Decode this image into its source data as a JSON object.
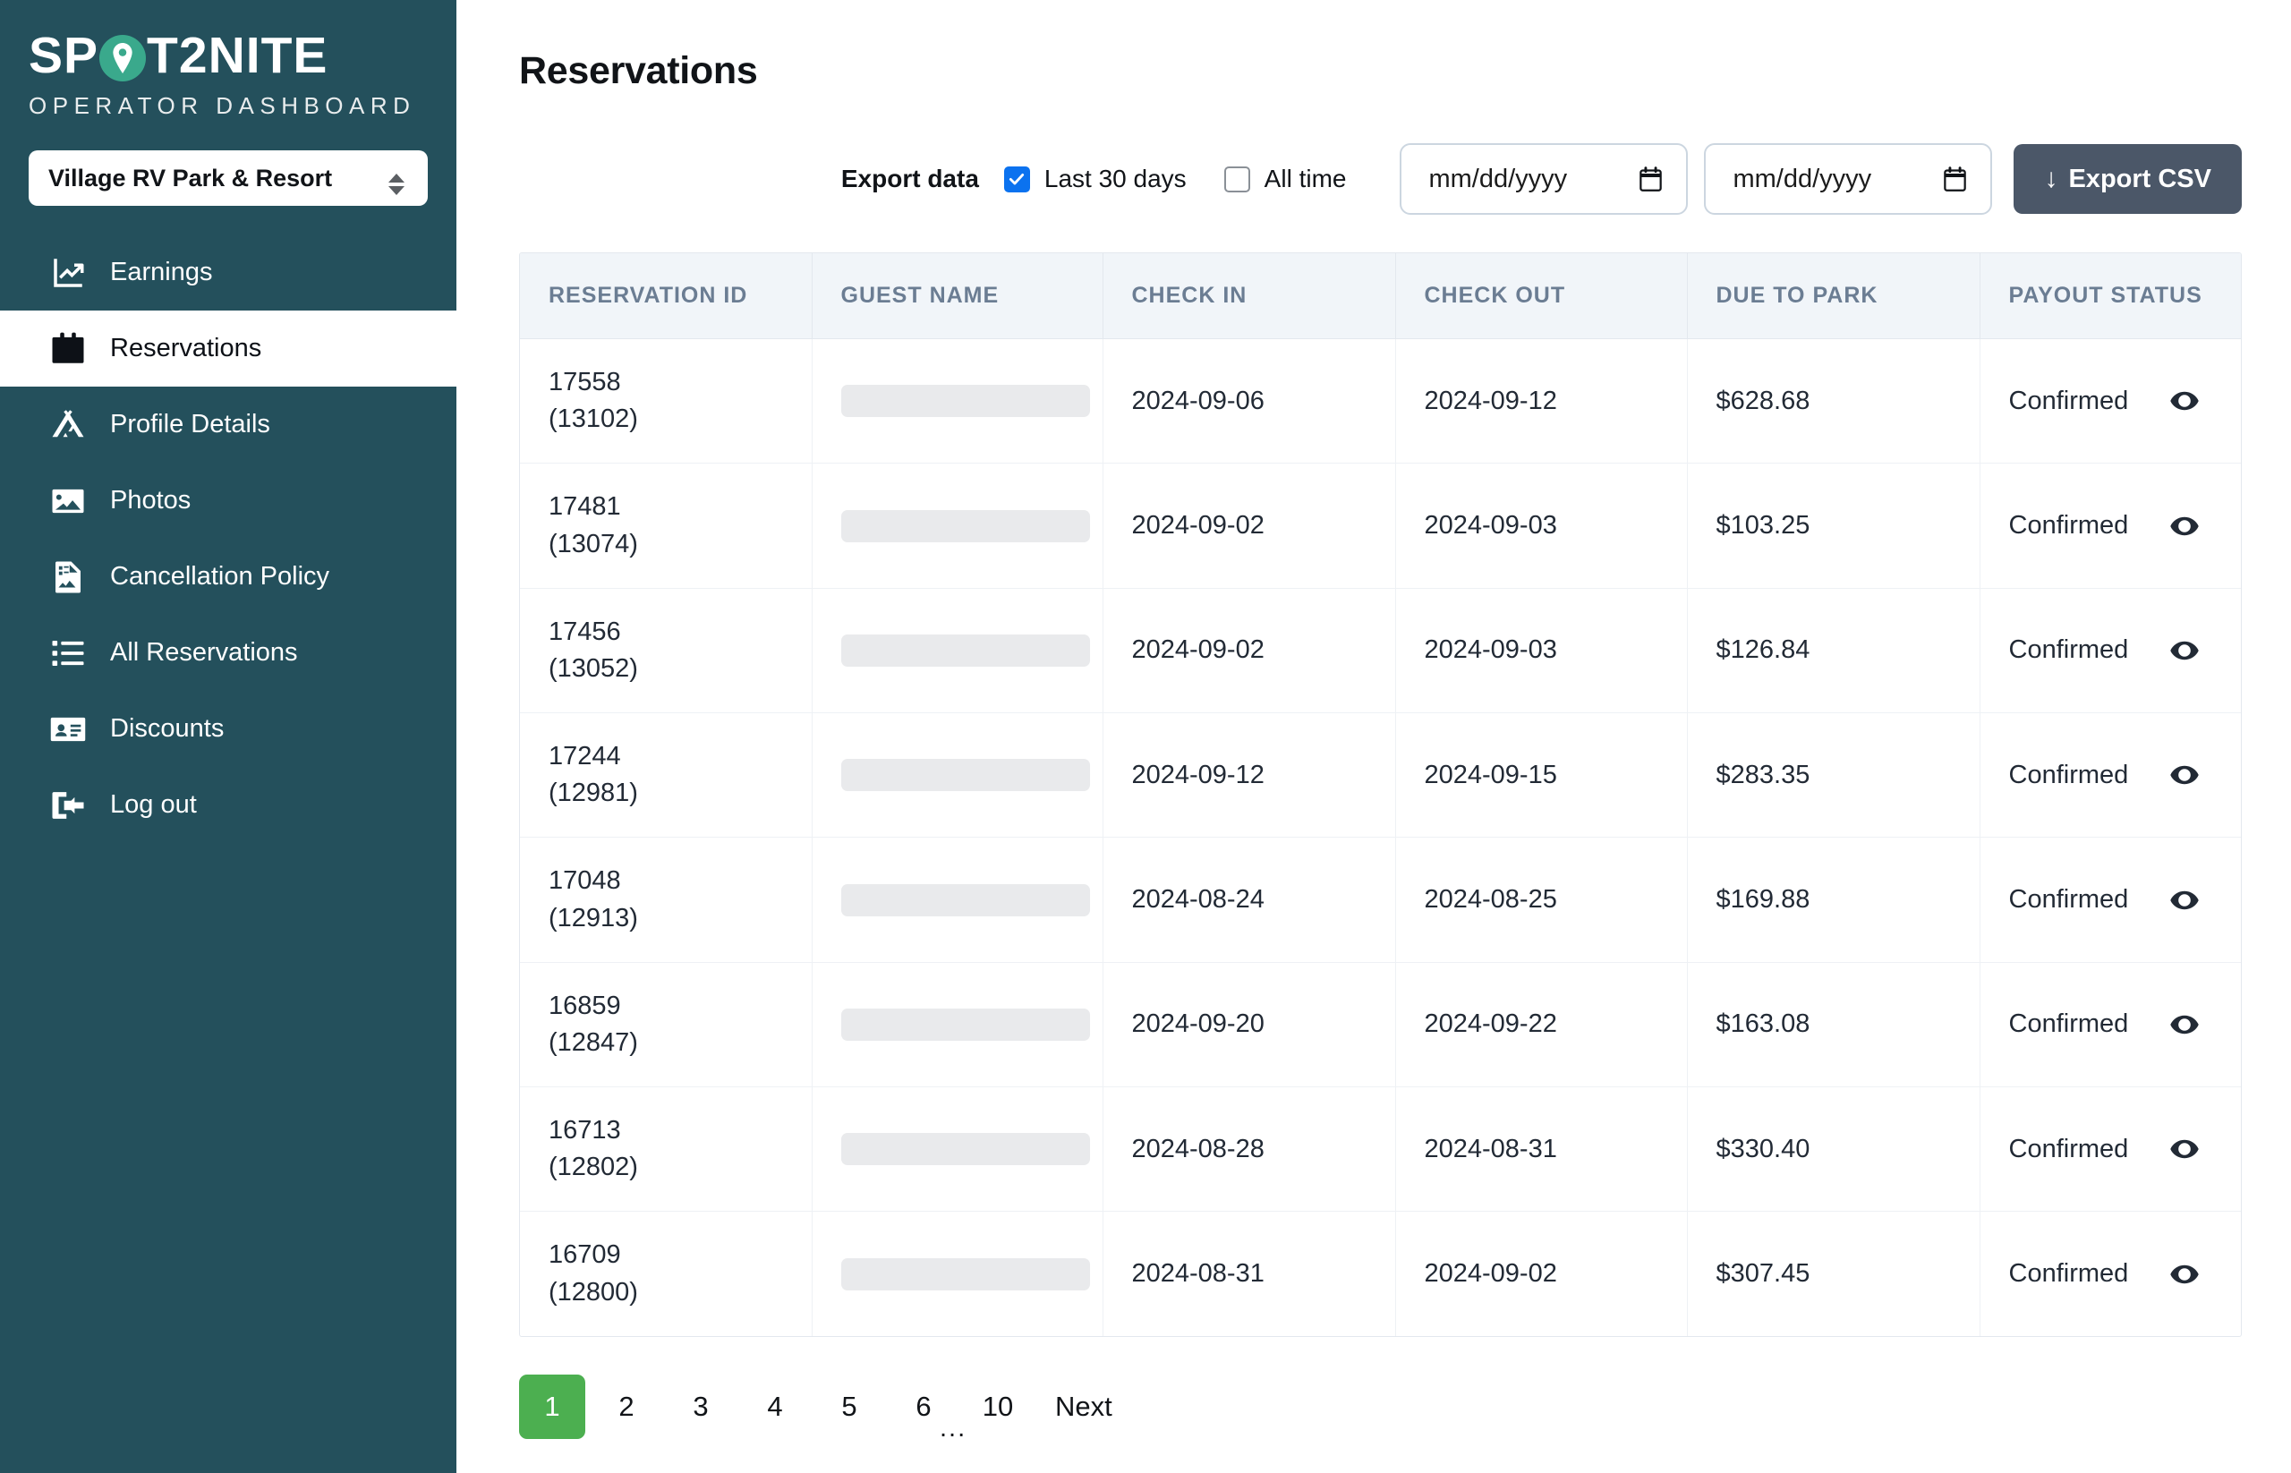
{
  "brand": {
    "name_part1": "SP",
    "name_part2": "T2NITE",
    "subtitle": "OPERATOR DASHBOARD",
    "accent_color": "#3aa98c",
    "sidebar_color": "#24505c"
  },
  "sidebar": {
    "park_selector_value": "Village RV Park & Resort",
    "items": [
      {
        "label": "Earnings",
        "icon": "chart-line-icon",
        "active": false
      },
      {
        "label": "Reservations",
        "icon": "calendar-icon",
        "active": true
      },
      {
        "label": "Profile Details",
        "icon": "tent-icon",
        "active": false
      },
      {
        "label": "Photos",
        "icon": "image-icon",
        "active": false
      },
      {
        "label": "Cancellation Policy",
        "icon": "document-icon",
        "active": false
      },
      {
        "label": "All Reservations",
        "icon": "list-icon",
        "active": false
      },
      {
        "label": "Discounts",
        "icon": "id-card-icon",
        "active": false
      },
      {
        "label": "Log out",
        "icon": "logout-icon",
        "active": false
      }
    ]
  },
  "header": {
    "title": "Reservations"
  },
  "export": {
    "label": "Export data",
    "last30_label": "Last 30 days",
    "last30_checked": true,
    "alltime_label": "All time",
    "alltime_checked": false,
    "start_date_placeholder": "mm/dd/yyyy",
    "start_date_value": "",
    "end_date_placeholder": "mm/dd/yyyy",
    "end_date_value": "",
    "button_label": "Export CSV",
    "button_icon": "download-arrow-icon",
    "button_color": "#4b5768",
    "checkbox_color": "#0b72ef"
  },
  "table": {
    "columns": [
      "RESERVATION ID",
      "GUEST NAME",
      "CHECK IN",
      "CHECK OUT",
      "DUE TO PARK",
      "PAYOUT STATUS"
    ],
    "rows": [
      {
        "id": "17558",
        "sub_id": "(13102)",
        "guest": "",
        "check_in": "2024-09-06",
        "check_out": "2024-09-12",
        "due": "$628.68",
        "status": "Confirmed"
      },
      {
        "id": "17481",
        "sub_id": "(13074)",
        "guest": "",
        "check_in": "2024-09-02",
        "check_out": "2024-09-03",
        "due": "$103.25",
        "status": "Confirmed"
      },
      {
        "id": "17456",
        "sub_id": "(13052)",
        "guest": "",
        "check_in": "2024-09-02",
        "check_out": "2024-09-03",
        "due": "$126.84",
        "status": "Confirmed"
      },
      {
        "id": "17244",
        "sub_id": "(12981)",
        "guest": "",
        "check_in": "2024-09-12",
        "check_out": "2024-09-15",
        "due": "$283.35",
        "status": "Confirmed"
      },
      {
        "id": "17048",
        "sub_id": "(12913)",
        "guest": "",
        "check_in": "2024-08-24",
        "check_out": "2024-08-25",
        "due": "$169.88",
        "status": "Confirmed"
      },
      {
        "id": "16859",
        "sub_id": "(12847)",
        "guest": "",
        "check_in": "2024-09-20",
        "check_out": "2024-09-22",
        "due": "$163.08",
        "status": "Confirmed"
      },
      {
        "id": "16713",
        "sub_id": "(12802)",
        "guest": "",
        "check_in": "2024-08-28",
        "check_out": "2024-08-31",
        "due": "$330.40",
        "status": "Confirmed"
      },
      {
        "id": "16709",
        "sub_id": "(12800)",
        "guest": "",
        "check_in": "2024-08-31",
        "check_out": "2024-09-02",
        "due": "$307.45",
        "status": "Confirmed"
      }
    ]
  },
  "pagination": {
    "pages": [
      "1",
      "2",
      "3",
      "4",
      "5",
      "6",
      "10"
    ],
    "current": "1",
    "ellipsis": "...",
    "next_label": "Next",
    "active_color": "#4caf50"
  }
}
